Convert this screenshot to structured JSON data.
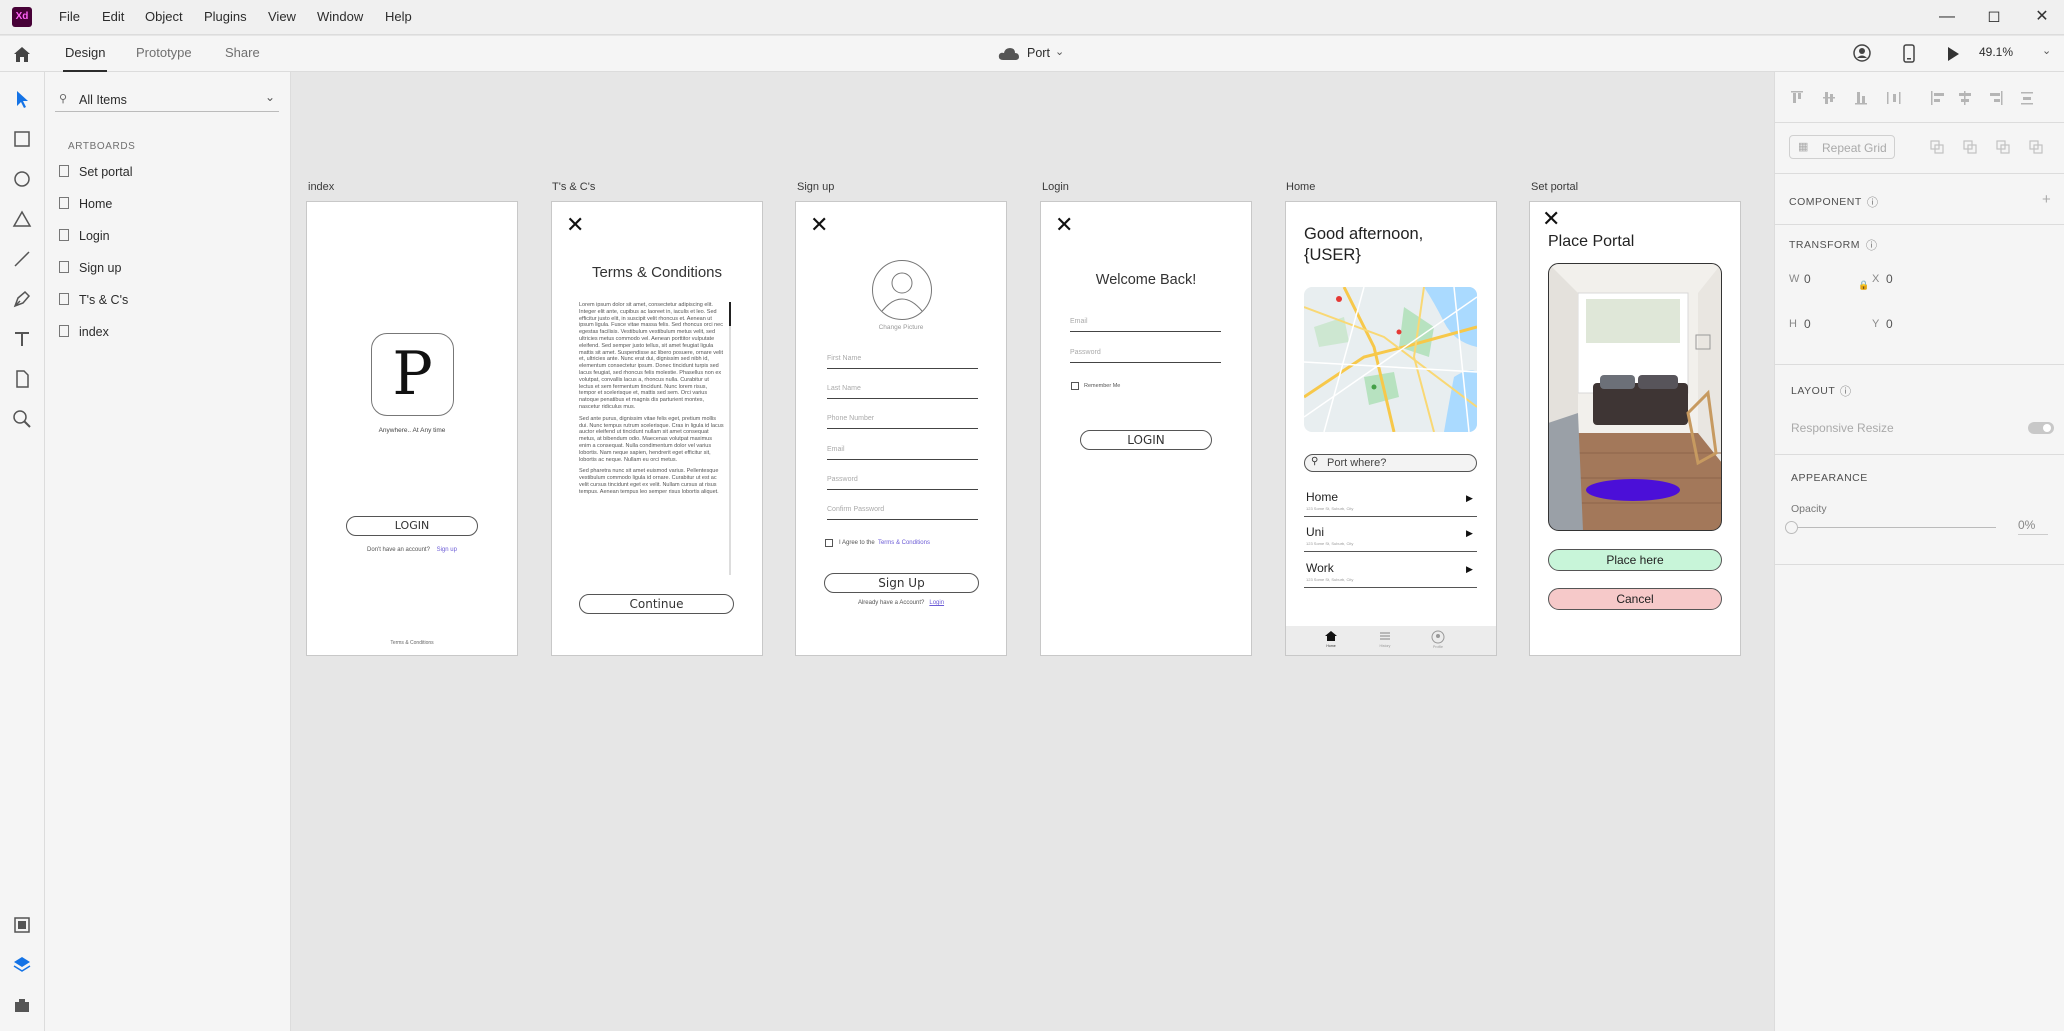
{
  "app": {
    "logo_text": "Xd",
    "menu": [
      "File",
      "Edit",
      "Object",
      "Plugins",
      "View",
      "Window",
      "Help"
    ],
    "tabs": [
      "Design",
      "Prototype",
      "Share"
    ],
    "doc_title": "Port",
    "zoom": "49.1%"
  },
  "layers": {
    "filter": "All Items",
    "section": "ARTBOARDS",
    "items": [
      "Set portal",
      "Home",
      "Login",
      "Sign up",
      "T's & C's",
      "index"
    ]
  },
  "props": {
    "repeat_grid": "Repeat Grid",
    "component": "COMPONENT",
    "transform": "TRANSFORM",
    "w_label": "W",
    "w_val": "0",
    "x_label": "X",
    "x_val": "0",
    "h_label": "H",
    "h_val": "0",
    "y_label": "Y",
    "y_val": "0",
    "layout": "LAYOUT",
    "responsive": "Responsive Resize",
    "appearance": "APPEARANCE",
    "opacity_label": "Opacity",
    "opacity_val": "0%"
  },
  "artboards": {
    "index": {
      "label": "index",
      "logo_letter": "P",
      "tagline": "Anywhere.. At Any time",
      "login": "LOGIN",
      "no_account": "Don't have an account?",
      "signup_link": "Sign up",
      "terms": "Terms & Conditions"
    },
    "tcs": {
      "label": "T's & C's",
      "title": "Terms & Conditions",
      "para1": "Lorem ipsum dolor sit amet, consectetur adipiscing elit. Integer elit ante, cupibus ac laoreet in, iaculis et leo. Sed efficitur justo elit, in suscipit velit rhoncus et. Aenean ut ipsum ligula. Fusce vitae massa felis. Sed rhoncus orci nec egestas facilisis. Vestibulum vestibulum metus velit, sed ultricies metus commodo vel. Aenean porttitor vulputate eleifend. Sed semper justo tellus, sit amet feugiat ligula mattis sit amet. Suspendisse ac libero posuere, ornare velit et, ultricies ante. Nunc erat dui, dignissim sed nibh id, elementum consectetur ipsum. Donec tincidunt turpis sed lacus feugiat, sed rhoncus felis molestie. Phasellus non ex volutpat, convallis lacus a, rhoncus nulla. Curabitur ut lectus et sem fermentum tincidunt. Nunc lorem risus, tempor et scelerisque et, mattis sed sem. Orci varius natoque penatibus et magnis dis parturient montes, nascetur ridiculus mus.",
      "para2": "Sed ante purus, dignissim vitae felis eget, pretium mollis dui. Nunc tempus rutrum scelerisque. Cras in ligula id lacus auctor eleifend ut tincidunt nullam sit amet consequat metus, at bibendum odio. Maecenas volutpat maximus enim a consequat. Nulla condimentum dolor vel varius lobortis. Nam neque sapien, hendrerit eget efficitur sit, lobortis ac neque. Nullam eu orci metus.",
      "para3": "Sed pharetra nunc sit amet euismod varius. Pellentesque vestibulum commodo ligula id ornare. Curabitur ut est ac velit cursus tincidunt eget ex velit. Nullam cursus at risus tempus. Aenean tempus leo semper risus lobortis aliquet.",
      "continue": "Continue"
    },
    "signup": {
      "label": "Sign up",
      "change_picture": "Change Picture",
      "fields": [
        "First Name",
        "Last Name",
        "Phone Number",
        "Email",
        "Password",
        "Confirm Password"
      ],
      "agree": "I Agree to the",
      "terms_link": "Terms & Conditions",
      "button": "Sign Up",
      "have_account": "Already have a Account?",
      "login_link": "Login"
    },
    "login": {
      "label": "Login",
      "title": "Welcome Back!",
      "fields": [
        "Email",
        "Password"
      ],
      "remember": "Remember Me",
      "button": "LOGIN"
    },
    "home": {
      "label": "Home",
      "greeting_line1": "Good afternoon,",
      "greeting_line2": "{USER}",
      "search_placeholder": "Port where?",
      "places": [
        {
          "name": "Home",
          "sub": "123 Some St, Suburb, City"
        },
        {
          "name": "Uni",
          "sub": "123 Some St, Suburb, City"
        },
        {
          "name": "Work",
          "sub": "123 Some St, Suburb, City"
        }
      ],
      "nav": [
        "Home",
        "History",
        "Profile"
      ]
    },
    "setportal": {
      "label": "Set portal",
      "title": "Place Portal",
      "place_button": "Place here",
      "cancel_button": "Cancel"
    }
  },
  "colors": {
    "accent_blue": "#1473e6",
    "link": "#6b5bd6",
    "portal": "#4b0fd8",
    "place_bg": "#c8f5d9",
    "cancel_bg": "#f6c9c9"
  }
}
